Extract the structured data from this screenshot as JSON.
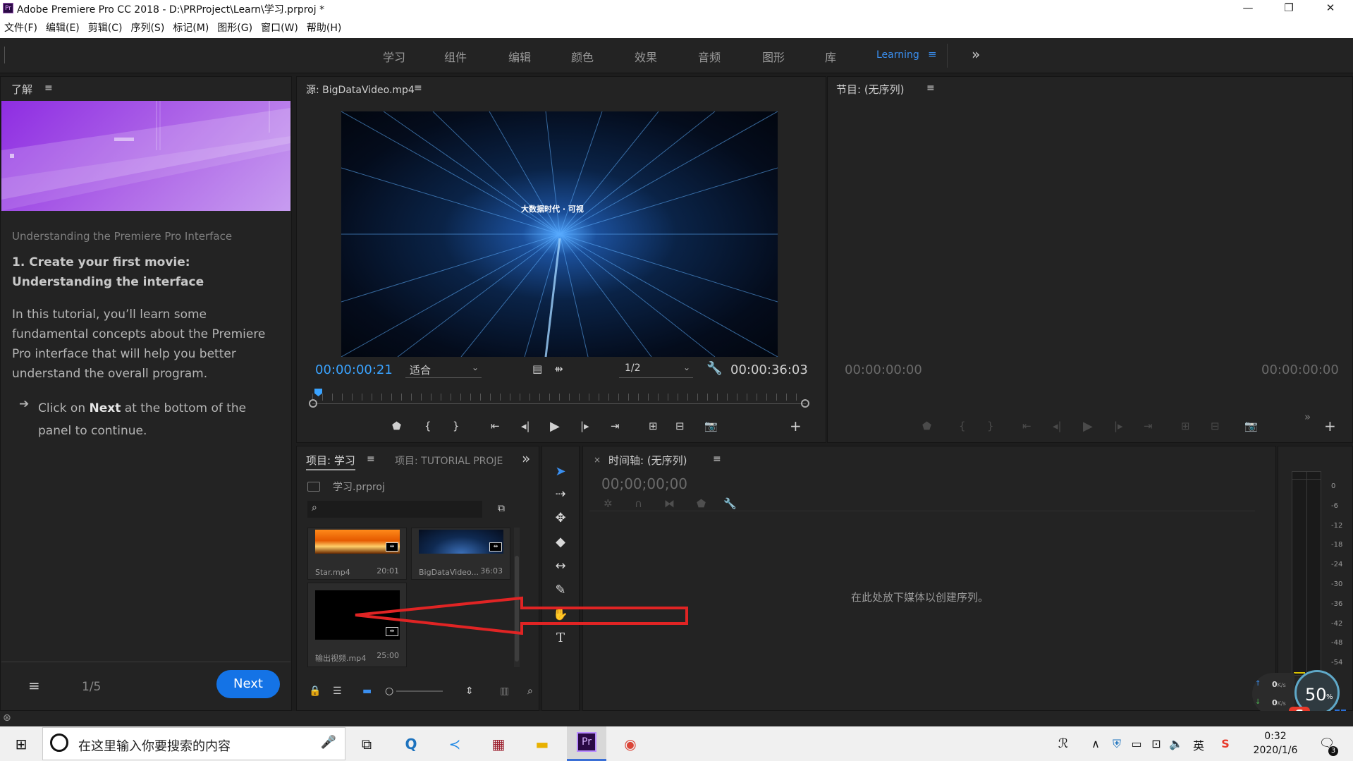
{
  "window": {
    "title": "Adobe Premiere Pro CC 2018 - D:\\PRProject\\Learn\\学习.prproj *",
    "app_icon": "Pr",
    "minimize": "—",
    "maximize": "❐",
    "close": "✕"
  },
  "menu": [
    "文件(F)",
    "编辑(E)",
    "剪辑(C)",
    "序列(S)",
    "标记(M)",
    "图形(G)",
    "窗口(W)",
    "帮助(H)"
  ],
  "workspaces": [
    "学习",
    "组件",
    "编辑",
    "颜色",
    "效果",
    "音频",
    "图形",
    "库"
  ],
  "workspace_active": "Learning",
  "workspace_more": "»",
  "learn": {
    "panel_title": "了解",
    "subtitle": "Understanding the Premiere Pro Interface",
    "heading": "1. Create your first movie: Understanding the interface",
    "body": "In this tutorial, you’ll learn some fundamental concepts about the Premiere Pro interface that will help you better understand the overall program.",
    "step_prefix": "Click on ",
    "step_bold": "Next",
    "step_suffix": " at the bottom of the panel to continue.",
    "page": "1/5",
    "next": "Next"
  },
  "source": {
    "title": "源: BigDataVideo.mp4",
    "timecode": "00:00:00:21",
    "fit": "适合",
    "resolution": "1/2",
    "duration": "00:00:36:03",
    "overlay_text": "大数据时代 · 可视"
  },
  "program": {
    "title": "节目: (无序列)",
    "tc_left": "00:00:00:00",
    "tc_right": "00:00:00:00"
  },
  "project": {
    "tab_active": "项目: 学习",
    "tab_other": "项目: TUTORIAL PROJE",
    "project_file": "学习.prproj",
    "items": [
      {
        "name": "Star.mp4",
        "duration": "20:01"
      },
      {
        "name": "BigDataVideo...",
        "duration": "36:03"
      },
      {
        "name": "输出视频.mp4",
        "duration": "25:00"
      }
    ]
  },
  "timeline": {
    "title": "时间轴: (无序列)",
    "timecode": "00;00;00;00",
    "drop_hint": "在此处放下媒体以创建序列。"
  },
  "meters": {
    "scale": [
      "0",
      "-6",
      "-12",
      "-18",
      "-24",
      "-30",
      "-36",
      "-42",
      "-48",
      "-54"
    ]
  },
  "overlay": {
    "up_speed": "0",
    "down_speed": "0",
    "speed_unit": "K/s",
    "percent": "50",
    "percent_unit": "%",
    "ime": "英"
  },
  "taskbar": {
    "search_placeholder": "在这里输入你要搜索的内容",
    "lang": "英",
    "time": "0:32",
    "date": "2020/1/6",
    "notif_count": "3"
  },
  "colors": {
    "accent_blue": "#1473e6",
    "timecode_blue": "#3aa3ff",
    "arrow_red": "#e02424"
  }
}
